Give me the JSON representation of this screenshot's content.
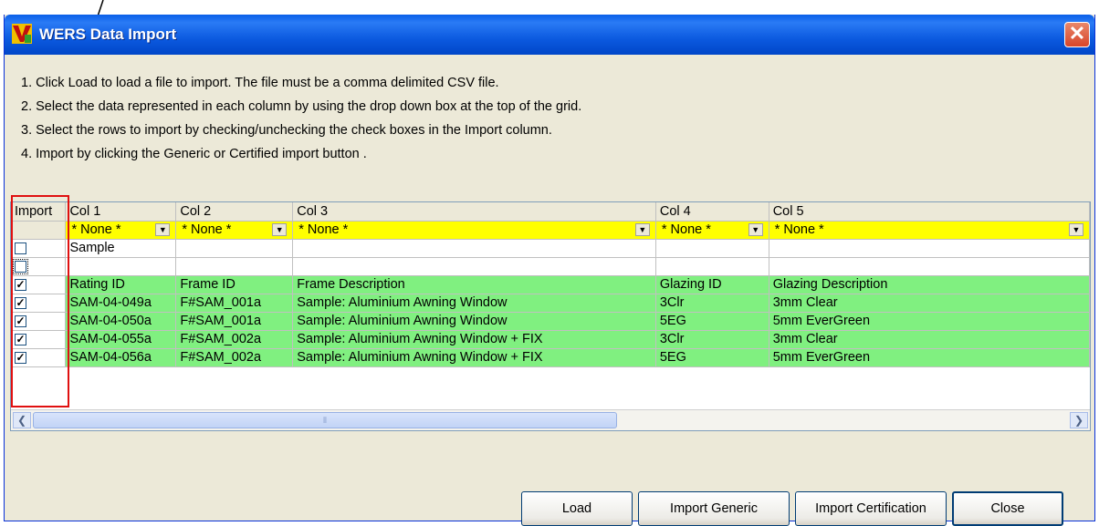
{
  "window": {
    "title": "WERS Data Import",
    "close_glyph": "✕"
  },
  "instructions": [
    "1. Click Load to load a file to import. The file must be a comma delimited CSV file.",
    "2. Select the data represented in each column by using the drop down box at the top of the grid.",
    "3. Select the rows to import by checking/unchecking the check boxes in the Import column.",
    "4. Import by clicking the Generic or Certified import button ."
  ],
  "grid": {
    "import_header": "Import",
    "columns": [
      "Col 1",
      "Col 2",
      "Col 3",
      "Col 4",
      "Col 5"
    ],
    "selectors": [
      "* None *",
      "* None *",
      "* None *",
      "* None *",
      "* None *"
    ],
    "rows": [
      {
        "checked": false,
        "cells": [
          "Sample",
          "",
          "",
          "",
          ""
        ]
      },
      {
        "checked": false,
        "cells": [
          "",
          "",
          "",
          "",
          ""
        ]
      },
      {
        "checked": true,
        "cells": [
          "Rating ID",
          "Frame ID",
          "Frame Description",
          "Glazing ID",
          "Glazing Description"
        ]
      },
      {
        "checked": true,
        "cells": [
          "SAM-04-049a",
          "F#SAM_001a",
          "Sample: Aluminium Awning Window",
          "3Clr",
          "3mm Clear"
        ]
      },
      {
        "checked": true,
        "cells": [
          "SAM-04-050a",
          "F#SAM_001a",
          "Sample: Aluminium Awning Window",
          "5EG",
          "5mm EverGreen"
        ]
      },
      {
        "checked": true,
        "cells": [
          "SAM-04-055a",
          "F#SAM_002a",
          "Sample: Aluminium Awning Window + FIX",
          "3Clr",
          "3mm Clear"
        ]
      },
      {
        "checked": true,
        "cells": [
          "SAM-04-056a",
          "F#SAM_002a",
          "Sample: Aluminium Awning Window + FIX",
          "5EG",
          "5mm EverGreen"
        ]
      }
    ]
  },
  "buttons": {
    "load": "Load",
    "import_generic": "Import Generic",
    "import_certification": "Import Certification",
    "close": "Close"
  },
  "colors": {
    "selector_row": "#ffff00",
    "data_rows": "#80f080",
    "annotation": "#e01010"
  }
}
